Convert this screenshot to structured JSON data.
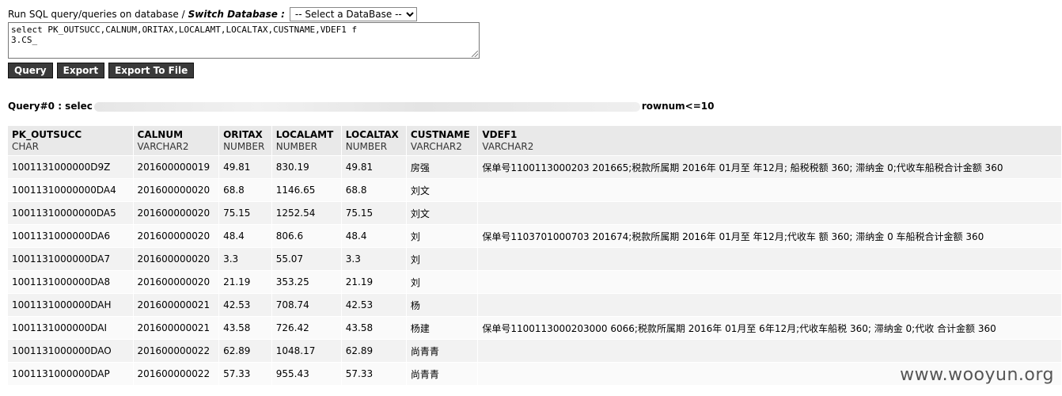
{
  "header": {
    "run_label": "Run SQL query/queries on database / ",
    "switch_label": "Switch Database :",
    "db_select_value": "-- Select a DataBase --"
  },
  "sql_editor": {
    "line1": "select PK_OUTSUCC,CALNUM,ORITAX,LOCALAMT,LOCALTAX,CUSTNAME,VDEF1 f",
    "line2": "3.CS_"
  },
  "toolbar": {
    "query_label": "Query",
    "export_label": "Export",
    "export_file_label": "Export To File"
  },
  "query_info": {
    "prefix": "Query#0 : selec",
    "suffix": "rownum<=10"
  },
  "table": {
    "columns": [
      {
        "name": "PK_OUTSUCC",
        "type": "CHAR"
      },
      {
        "name": "CALNUM",
        "type": "VARCHAR2"
      },
      {
        "name": "ORITAX",
        "type": "NUMBER"
      },
      {
        "name": "LOCALAMT",
        "type": "NUMBER"
      },
      {
        "name": "LOCALTAX",
        "type": "NUMBER"
      },
      {
        "name": "CUSTNAME",
        "type": "VARCHAR2"
      },
      {
        "name": "VDEF1",
        "type": "VARCHAR2"
      }
    ],
    "rows": [
      [
        "1001131000000D9Z",
        "201600000019",
        "49.81",
        "830.19",
        "49.81",
        "房强",
        "保单号1100113000203 201665;税款所属期 2016年 01月至 年12月; 船税税额 360; 滞纳金 0;代收车船税合计金额 360"
      ],
      [
        "10011310000000DA4",
        "201600000020",
        "68.8",
        "1146.65",
        "68.8",
        "刘文",
        ""
      ],
      [
        "10011310000000DA5",
        "201600000020",
        "75.15",
        "1252.54",
        "75.15",
        "刘文",
        ""
      ],
      [
        "1001131000000DA6",
        "201600000020",
        "48.4",
        "806.6",
        "48.4",
        "刘",
        "保单号1103701000703 201674;税款所属期 2016年 01月至 年12月;代收车 额 360; 滞纳金 0 车船税合计金额 360"
      ],
      [
        "1001131000000DA7",
        "201600000020",
        "3.3",
        "55.07",
        "3.3",
        "刘",
        ""
      ],
      [
        "1001131000000DA8",
        "201600000020",
        "21.19",
        "353.25",
        "21.19",
        "刘",
        ""
      ],
      [
        "1001131000000DAH",
        "201600000021",
        "42.53",
        "708.74",
        "42.53",
        "杨",
        ""
      ],
      [
        "1001131000000DAI",
        "201600000021",
        "43.58",
        "726.42",
        "43.58",
        "杨建",
        "保单号1100113000203000 6066;税款所属期 2016年 01月至 6年12月;代收车船税 360; 滞纳金 0;代收 合计金额 360"
      ],
      [
        "1001131000000DAO",
        "201600000022",
        "62.89",
        "1048.17",
        "62.89",
        "尚青青",
        ""
      ],
      [
        "1001131000000DAP",
        "201600000022",
        "57.33",
        "955.43",
        "57.33",
        "尚青青",
        ""
      ]
    ]
  },
  "watermark": "www.wooyun.org"
}
